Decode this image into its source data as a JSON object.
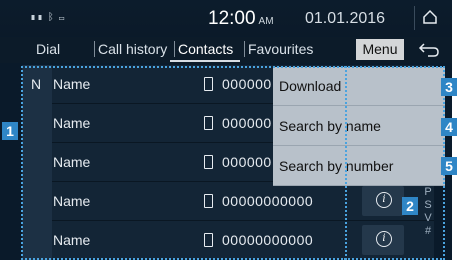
{
  "status_bar": {
    "time": "12:00",
    "ampm": "AM",
    "date": "01.01.2016",
    "icons": "signal-icon bluetooth-icon battery-icon"
  },
  "tabs": [
    {
      "label": "Dial"
    },
    {
      "label": "Call history"
    },
    {
      "label": "Contacts",
      "active": true
    },
    {
      "label": "Favourites"
    }
  ],
  "menu_label": "Menu",
  "index_letter": "N",
  "contacts": [
    {
      "name": "Name",
      "number": "000000"
    },
    {
      "name": "Name",
      "number": "000000"
    },
    {
      "name": "Name",
      "number": "000000"
    },
    {
      "name": "Name",
      "number": "00000000000"
    },
    {
      "name": "Name",
      "number": "00000000000"
    }
  ],
  "alphabet_index": [
    "P",
    "S",
    "V",
    "#"
  ],
  "dropdown_menu": [
    {
      "label": "Download",
      "callout": "3"
    },
    {
      "label": "Search by name",
      "callout": "4"
    },
    {
      "label": "Search by number",
      "callout": "5"
    }
  ],
  "callouts": {
    "list": "1",
    "info": "2"
  },
  "colors": {
    "background": "#0a1a2a",
    "accent": "#2f86c6",
    "menu_bg": "#b8c1ca"
  }
}
